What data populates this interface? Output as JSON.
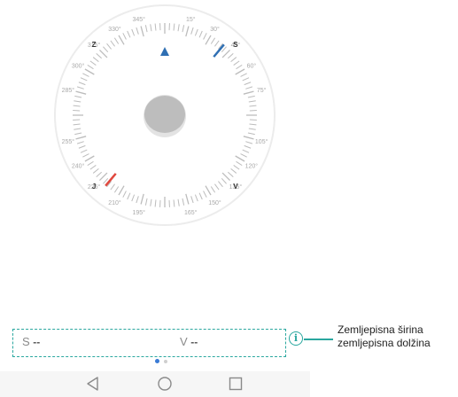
{
  "compass": {
    "degree_labels": [
      "15°",
      "30°",
      "45°",
      "60°",
      "75°",
      "105°",
      "120°",
      "135°",
      "150°",
      "165°",
      "195°",
      "210°",
      "225°",
      "240°",
      "255°",
      "285°",
      "300°",
      "315°",
      "330°",
      "345°"
    ],
    "cardinals": {
      "north": "S",
      "east": "V",
      "south": "J",
      "west": "Z"
    },
    "colors": {
      "north_needle": "#2f6fb3",
      "south_needle": "#e0483e",
      "pointer": "#2f6fb3",
      "center": "#bdbdbd",
      "ticks": "#bcbcbc"
    }
  },
  "coordinates": {
    "lat_prefix": "S",
    "lat_value": "--",
    "lon_prefix": "V",
    "lon_value": "--"
  },
  "info_icon": "i",
  "callout": {
    "line1": "Zemljepisna širina",
    "line2": "zemljepisna dolžina"
  },
  "pager": {
    "pages": 2,
    "active": 1
  },
  "navbar": {
    "icons": [
      "back-icon",
      "home-icon",
      "recents-icon"
    ]
  }
}
